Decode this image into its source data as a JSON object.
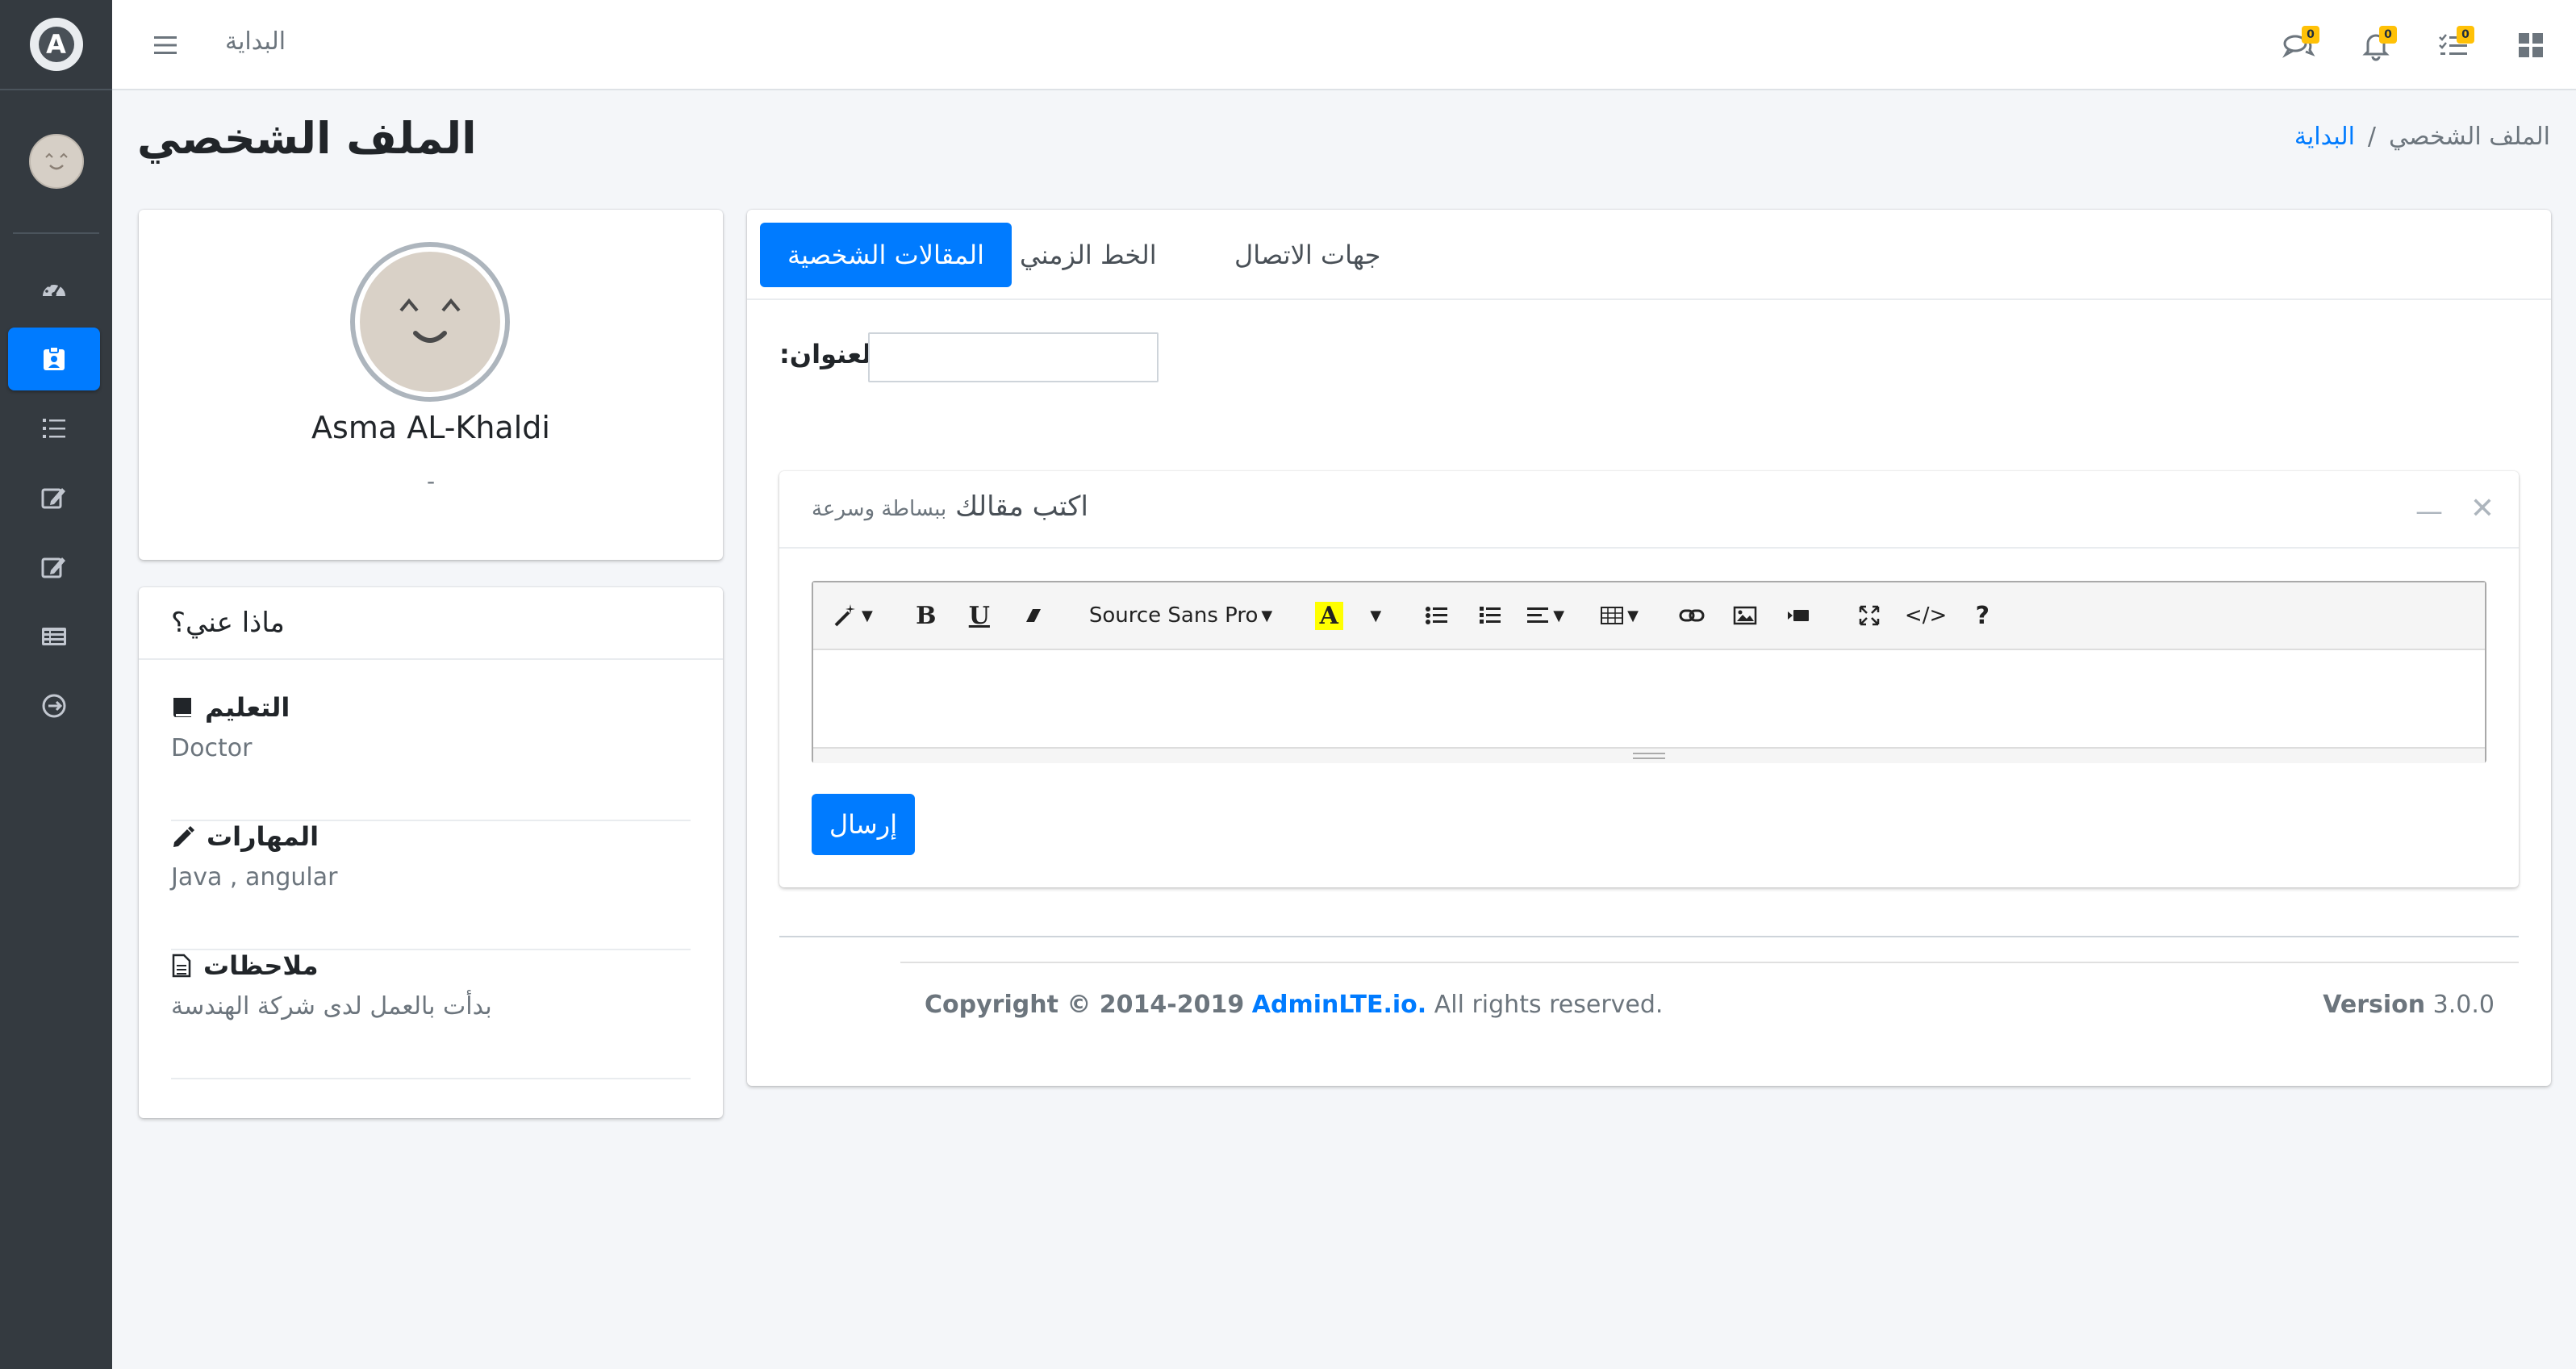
{
  "sidebar": {
    "brand_letter": "A",
    "items": [
      {
        "icon": "dashboard-icon",
        "active": false
      },
      {
        "icon": "profile-card-icon",
        "active": true
      },
      {
        "icon": "list-icon",
        "active": false
      },
      {
        "icon": "edit-icon",
        "active": false
      },
      {
        "icon": "edit-icon",
        "active": false
      },
      {
        "icon": "table-icon",
        "active": false
      },
      {
        "icon": "logout-icon",
        "active": false
      }
    ]
  },
  "topbar": {
    "home_link": "البداية",
    "messages_count": "0",
    "notifications_count": "0",
    "tasks_count": "0"
  },
  "header": {
    "title": "الملف الشخصي",
    "breadcrumb_home": "البداية",
    "breadcrumb_sep": "/",
    "breadcrumb_current": "الملف الشخصي"
  },
  "profile": {
    "name": "Asma AL-Khaldi",
    "subtitle": "-"
  },
  "about": {
    "header": "ماذا عني؟",
    "education_title": "التعليم",
    "education_value": "Doctor",
    "skills_title": "المهارات",
    "skills_value": "Java , angular",
    "notes_title": "ملاحظات",
    "notes_value": "بدأت بالعمل لدى شركة الهندسة"
  },
  "tabs": {
    "articles": "المقالات الشخصية",
    "timeline": "الخط الزمني",
    "contacts": "جهات الاتصال"
  },
  "form": {
    "title_label": ":العنوان",
    "title_value": "",
    "editor_title": "اكتب مقالك",
    "editor_subtitle": "ببساطة وسرعة",
    "font_name": "Source Sans Pro",
    "send_label": "إرسال"
  },
  "footer": {
    "copyright_prefix": "Copyright © 2014-2019",
    "brand": "AdminLTE.io.",
    "rights": "All rights reserved.",
    "version_label": "Version",
    "version_value": "3.0.0"
  },
  "colors": {
    "primary": "#007bff",
    "sidebar": "#343a40",
    "badge": "#ffc107"
  }
}
